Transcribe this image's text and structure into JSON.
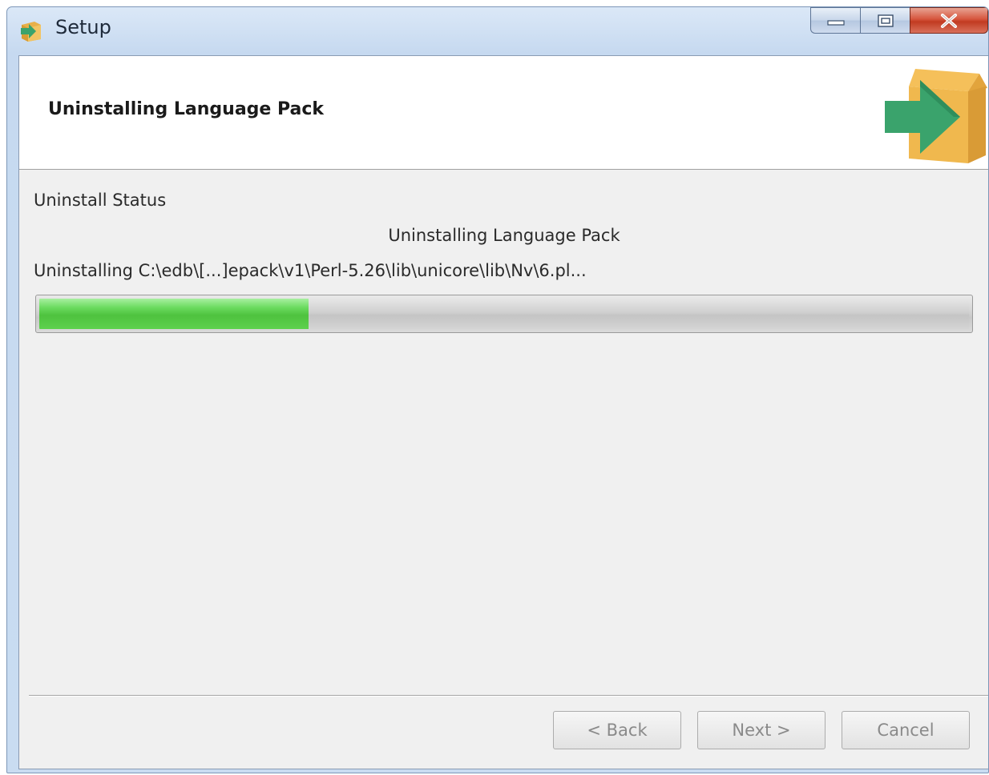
{
  "window": {
    "title": "Setup"
  },
  "header": {
    "title": "Uninstalling Language Pack"
  },
  "status": {
    "section_label": "Uninstall Status",
    "current_action": "Uninstalling Language Pack",
    "current_file": "Uninstalling C:\\edb\\[...]epack\\v1\\Perl-5.26\\lib\\unicore\\lib\\Nv\\6.pl...",
    "progress_fraction": 0.29
  },
  "buttons": {
    "back_label": "< Back",
    "next_label": "Next >",
    "cancel_label": "Cancel"
  },
  "colors": {
    "progress_green": "#5ed14e",
    "title_bar_blue": "#c9dcf1",
    "close_red": "#c13b21"
  },
  "icons": {
    "app": "installer-box-arrow-icon",
    "logo": "installer-box-arrow-icon",
    "minimize": "minimize-icon",
    "maximize": "maximize-icon",
    "close": "close-icon"
  }
}
